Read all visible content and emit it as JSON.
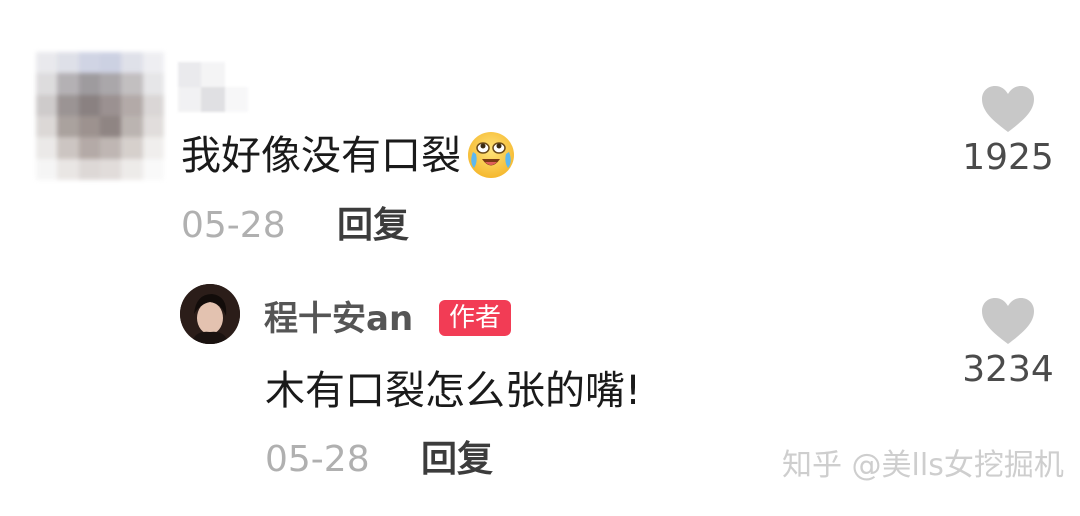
{
  "comment": {
    "text": "我好像没有口裂",
    "emoji": "crying-laughing-emoji",
    "date": "05-28",
    "reply_label": "回复",
    "like_icon": "heart-icon",
    "like_count": "1925"
  },
  "reply": {
    "author_name": "程十安an",
    "author_badge": "作者",
    "text": "木有口裂怎么张的嘴!",
    "date": "05-28",
    "reply_label": "回复",
    "like_icon": "heart-icon",
    "like_count": "3234"
  },
  "watermark": {
    "text": "知乎 @美lls女挖掘机"
  },
  "colors": {
    "badge": "#f23c55",
    "heart": "#c8c8c8",
    "meta": "#b0b0b0"
  }
}
